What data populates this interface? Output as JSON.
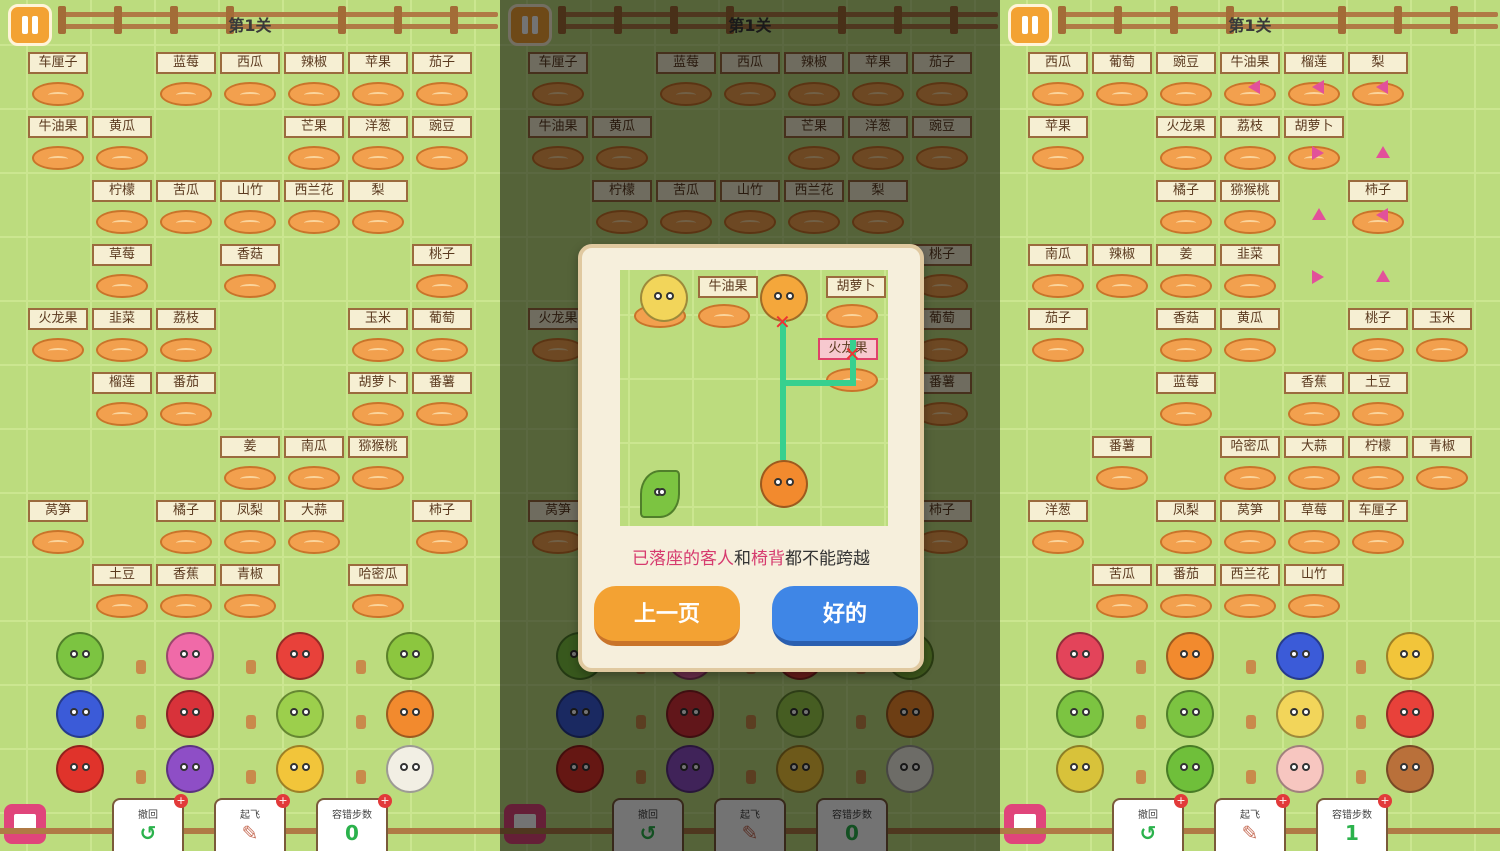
{
  "level_title": "第1关",
  "colors": {
    "grass": "#bcdc7e",
    "sign": "#f6efd3",
    "cushion": "#f2a04e",
    "accent_pink": "#d63a6e",
    "btn_orange": "#f3a233",
    "btn_blue": "#3f86e6",
    "undo_green": "#2bb24c"
  },
  "panel1": {
    "labels": [
      "车厘子",
      "蓝莓",
      "西瓜",
      "辣椒",
      "苹果",
      "茄子",
      "牛油果",
      "黄瓜",
      "芒果",
      "洋葱",
      "豌豆",
      "柠檬",
      "苦瓜",
      "山竹",
      "西兰花",
      "梨",
      "草莓",
      "香菇",
      "桃子",
      "火龙果",
      "韭菜",
      "荔枝",
      "玉米",
      "葡萄",
      "榴莲",
      "番茄",
      "胡萝卜",
      "番薯",
      "姜",
      "南瓜",
      "猕猴桃",
      "莴笋",
      "橘子",
      "凤梨",
      "大蒜",
      "柿子",
      "土豆",
      "香蕉",
      "青椒",
      "哈密瓜"
    ]
  },
  "panel3": {
    "labels": [
      "西瓜",
      "葡萄",
      "豌豆",
      "牛油果",
      "榴莲",
      "梨",
      "苹果",
      "火龙果",
      "荔枝",
      "胡萝卜",
      "橘子",
      "猕猴桃",
      "柿子",
      "南瓜",
      "辣椒",
      "姜",
      "韭菜",
      "茄子",
      "香菇",
      "黄瓜",
      "桃子",
      "玉米",
      "蓝莓",
      "香蕉",
      "土豆",
      "番薯",
      "哈密瓜",
      "大蒜",
      "柠檬",
      "青椒",
      "洋葱",
      "凤梨",
      "莴笋",
      "草莓",
      "车厘子",
      "苦瓜",
      "番茄",
      "西兰花",
      "山竹"
    ]
  },
  "bottom_bar": {
    "undo_label": "撤回",
    "fly_label": "起飞",
    "steps_label": "容错步数",
    "steps_value_p1": "0",
    "steps_value_p3": "1",
    "plus": "+"
  },
  "dialog": {
    "tut_labels": [
      "牛油果",
      "胡萝卜",
      "火龙果"
    ],
    "tip_part1": "已落座的客人",
    "tip_part2": "和",
    "tip_part3": "椅背",
    "tip_part4": "都不能跨越",
    "prev_label": "上一页",
    "ok_label": "好的"
  }
}
